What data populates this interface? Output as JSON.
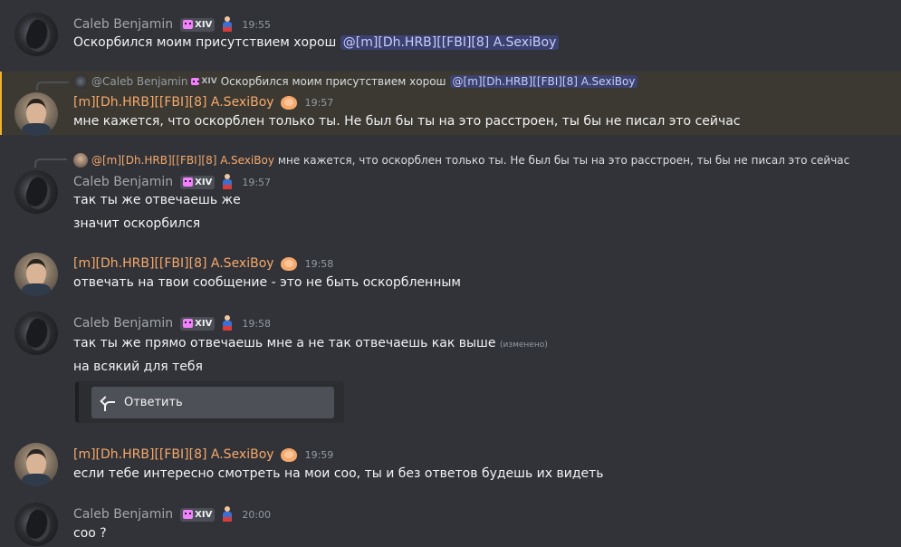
{
  "users": {
    "caleb": {
      "name": "Caleb Benjamin",
      "tag": "XIV"
    },
    "sexi": {
      "name": "[m][Dh.HRB][[FBI][8] A.SexiBoy"
    }
  },
  "messages": [
    {
      "time": "19:55",
      "lines": [
        "Оскорбился моим присутствием хорош"
      ],
      "mention": "@[m][Dh.HRB][[FBI][8] A.SexiBoy"
    },
    {
      "time": "19:57",
      "reply": {
        "name": "@Caleb Benjamin",
        "tag": "XIV",
        "text": "Оскорбился моим присутствием хорош",
        "mention": "@[m][Dh.HRB][[FBI][8] A.SexiBoy"
      },
      "lines": [
        "мне кажется, что оскорблен только ты. Не был бы ты на это расстроен, ты бы не писал это сейчас"
      ]
    },
    {
      "time": "19:57",
      "reply": {
        "name": "@[m][Dh.HRB][[FBI][8] A.SexiBoy",
        "text": "мне кажется, что оскорблен только ты. Не был бы ты на это расстроен, ты бы не писал это сейчас"
      },
      "lines": [
        "так ты же отвечаешь же",
        "значит оскорбился"
      ]
    },
    {
      "time": "19:58",
      "lines": [
        "отвечать на твои сообщение - это не быть оскорбленным"
      ]
    },
    {
      "time": "19:58",
      "lines": [
        "так ты же прямо отвечаешь мне а не так отвечаешь как выше",
        "на всякий для тебя"
      ],
      "edited": "(изменено)"
    },
    {
      "time": "19:59",
      "lines": [
        "если тебе интересно смотреть на мои соо, ты и без ответов будешь их видеть"
      ]
    },
    {
      "time": "20:00",
      "lines": [
        "соо ?"
      ]
    }
  ],
  "embed": {
    "button_label": "Ответить"
  },
  "colors": {
    "background": "#313338",
    "highlight": "#3b3932",
    "highlight_border": "#f0b232",
    "caleb": "#a3a6aa",
    "sexi": "#f6a96c",
    "mention_bg": "#3c4270"
  },
  "icons": {
    "server_tag": "cat-face-icon",
    "nitro": "superhero-icon",
    "role": "heart-icon",
    "reply": "reply-arrow-icon"
  }
}
